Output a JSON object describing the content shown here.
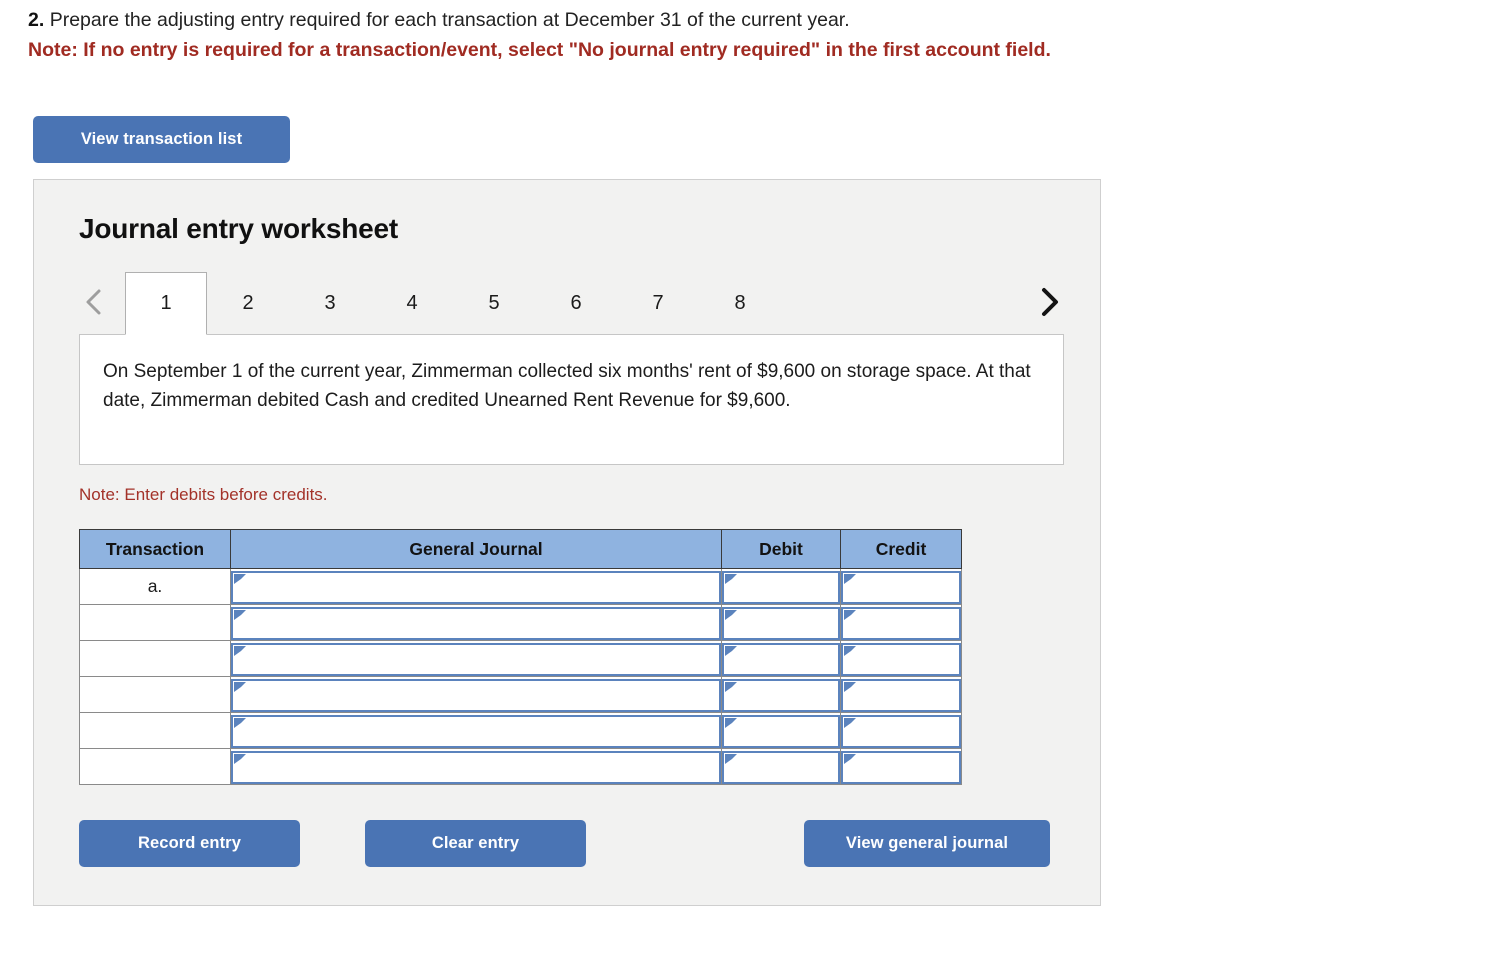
{
  "question": {
    "number": "2.",
    "text": "Prepare the adjusting entry required for each transaction at December 31 of the current year.",
    "note": "Note: If no entry is required for a transaction/event, select \"No journal entry required\" in the first account field."
  },
  "toolbar": {
    "view_transaction_list_label": "View transaction list"
  },
  "worksheet": {
    "title": "Journal entry worksheet",
    "prev_icon": "chevron-left-icon",
    "next_icon": "chevron-right-icon",
    "tabs": [
      {
        "label": "1",
        "active": true
      },
      {
        "label": "2",
        "active": false
      },
      {
        "label": "3",
        "active": false
      },
      {
        "label": "4",
        "active": false
      },
      {
        "label": "5",
        "active": false
      },
      {
        "label": "6",
        "active": false
      },
      {
        "label": "7",
        "active": false
      },
      {
        "label": "8",
        "active": false
      }
    ],
    "description": "On September 1 of the current year, Zimmerman collected six months' rent of $9,600 on storage space. At that date, Zimmerman debited Cash and credited Unearned Rent Revenue for $9,600.",
    "debit_note": "Note: Enter debits before credits."
  },
  "table": {
    "headers": [
      "Transaction",
      "General Journal",
      "Debit",
      "Credit"
    ],
    "rows": [
      {
        "transaction": "a.",
        "general_journal": "",
        "debit": "",
        "credit": ""
      },
      {
        "transaction": "",
        "general_journal": "",
        "debit": "",
        "credit": ""
      },
      {
        "transaction": "",
        "general_journal": "",
        "debit": "",
        "credit": ""
      },
      {
        "transaction": "",
        "general_journal": "",
        "debit": "",
        "credit": ""
      },
      {
        "transaction": "",
        "general_journal": "",
        "debit": "",
        "credit": ""
      },
      {
        "transaction": "",
        "general_journal": "",
        "debit": "",
        "credit": ""
      }
    ]
  },
  "actions": {
    "record_entry_label": "Record entry",
    "clear_entry_label": "Clear entry",
    "view_general_journal_label": "View general journal"
  },
  "colors": {
    "button_blue": "#4a74b4",
    "header_blue": "#8fb3e0",
    "note_red": "#a02b22",
    "debit_note_red": "#a33229",
    "panel_gray": "#f2f2f1",
    "cell_border_blue": "#5b83bd"
  }
}
